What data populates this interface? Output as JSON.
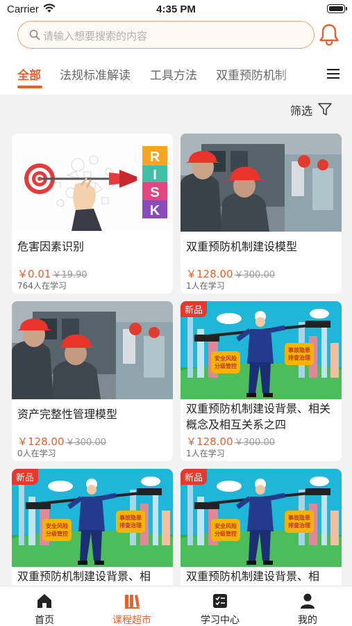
{
  "status_bar": {
    "carrier": "Carrier",
    "time": "4:35 PM"
  },
  "search": {
    "placeholder": "请输入想要搜索的内容"
  },
  "tabs": [
    {
      "label": "全部",
      "active": true
    },
    {
      "label": "法规标准解读"
    },
    {
      "label": "工具方法"
    },
    {
      "label": "双重预防机制"
    }
  ],
  "filter": {
    "label": "筛选"
  },
  "courses": [
    {
      "title": "危害因素识别",
      "price": "￥0.01",
      "old_price": "￥19.90",
      "learners": "764人在学习",
      "badge": "",
      "image": "risk-dart"
    },
    {
      "title": "双重预防机制建设模型",
      "price": "￥128.00",
      "old_price": "￥300.00",
      "learners": "1人在学习",
      "badge": "",
      "image": "workers-helmets"
    },
    {
      "title": "资产完整性管理模型",
      "price": "￥128.00",
      "old_price": "￥300.00",
      "learners": "0人在学习",
      "badge": "",
      "image": "workers-helmets"
    },
    {
      "title": "双重预防机制建设背景、相关概念及相互关系之四",
      "price": "￥128.00",
      "old_price": "￥300.00",
      "learners": "1人在学习",
      "badge": "新品",
      "image": "worker-balance"
    },
    {
      "title": "双重预防机制建设背景、相",
      "badge": "新品",
      "image": "worker-balance"
    },
    {
      "title": "双重预防机制建设背景、相",
      "badge": "新品",
      "image": "worker-balance"
    }
  ],
  "illustration_text": {
    "left_sign": "安全风险\n分级管控",
    "right_sign": "事故隐患\n排查治理",
    "risk_letters": [
      "R",
      "I",
      "S",
      "K"
    ]
  },
  "tabbar": [
    {
      "label": "首页",
      "icon": "home-icon"
    },
    {
      "label": "课程超市",
      "icon": "books-icon",
      "active": true
    },
    {
      "label": "学习中心",
      "icon": "checklist-icon"
    },
    {
      "label": "我的",
      "icon": "user-icon"
    }
  ],
  "colors": {
    "accent": "#e8602c",
    "badge": "#e8382c"
  }
}
